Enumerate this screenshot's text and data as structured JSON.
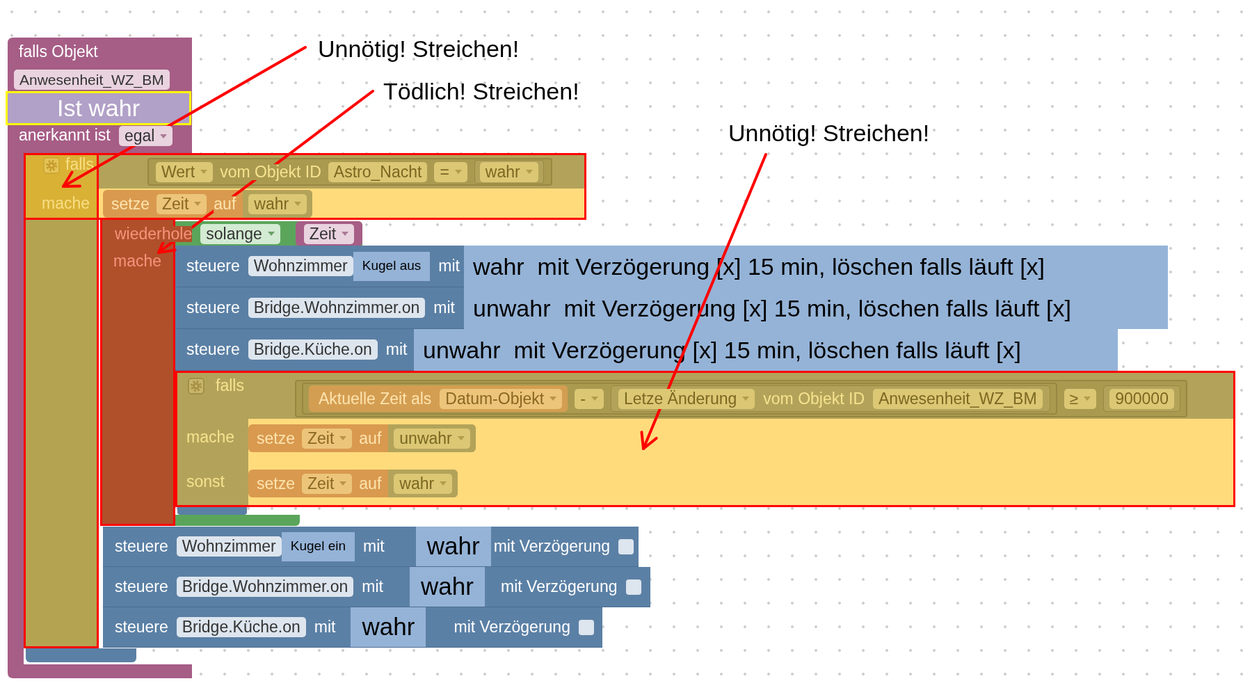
{
  "trigger_block": {
    "title": "falls Objekt",
    "object_id": "Anwesenheit_WZ_BM",
    "acknowledged_label": "anerkannt ist",
    "acknowledged_value": "egal"
  },
  "trigger_note": "Ist wahr",
  "astro_if_block": {
    "keyword": "falls",
    "condition": {
      "property": "Wert",
      "from_label": "vom Objekt ID",
      "object_id": "Astro_Nacht",
      "operator": "=",
      "value": "wahr"
    },
    "do_label": "mache",
    "statement": {
      "keyword": "setze",
      "variable": "Zeit",
      "to_label": "auf",
      "value": "wahr"
    }
  },
  "repeat_block": {
    "keyword": "wiederhole",
    "mode": "solange",
    "variable": "Zeit",
    "do_label": "mache",
    "control_statements": [
      {
        "keyword": "steuere",
        "object_id": "Wohnzimmer",
        "note": "Kugel aus",
        "with_label": "mit",
        "overlay_text": "wahr  mit Verzögerung [x] 15 min, löschen falls läuft [x]"
      },
      {
        "keyword": "steuere",
        "object_id": "Bridge.Wohnzimmer.on",
        "with_label": "mit",
        "overlay_text": "unwahr  mit Verzögerung [x] 15 min, löschen falls läuft [x]"
      },
      {
        "keyword": "steuere",
        "object_id": "Bridge.Küche.on",
        "with_label": "mit",
        "overlay_text": "unwahr  mit Verzögerung [x] 15 min, löschen falls läuft [x]"
      }
    ],
    "if_else_block": {
      "keyword": "falls",
      "condition": {
        "time_label": "Aktuelle Zeit als",
        "time_format": "Datum-Objekt",
        "math_operator": "-",
        "property": "Letze Änderung",
        "from_label": "vom Objekt ID",
        "object_id": "Anwesenheit_WZ_BM",
        "comparison": "≥",
        "threshold": "900000"
      },
      "do_label": "mache",
      "do_statement": {
        "keyword": "setze",
        "variable": "Zeit",
        "to_label": "auf",
        "value": "unwahr"
      },
      "else_label": "sonst",
      "else_statement": {
        "keyword": "setze",
        "variable": "Zeit",
        "to_label": "auf",
        "value": "wahr"
      }
    }
  },
  "control_statements": [
    {
      "keyword": "steuere",
      "object_id": "Wohnzimmer",
      "note": "Kugel ein",
      "with_label": "mit",
      "value": "wahr",
      "delay_label": "mit Verzögerung",
      "delay_checked": false
    },
    {
      "keyword": "steuere",
      "object_id": "Bridge.Wohnzimmer.on",
      "with_label": "mit",
      "value": "wahr",
      "delay_label": "mit Verzögerung",
      "delay_checked": false
    },
    {
      "keyword": "steuere",
      "object_id": "Bridge.Küche.on",
      "with_label": "mit",
      "value": "wahr",
      "delay_label": "mit Verzögerung",
      "delay_checked": false
    }
  ],
  "annotations": [
    {
      "text": "Unnötig! Streichen!"
    },
    {
      "text": "Tödlich! Streichen!"
    },
    {
      "text": "Unnötig! Streichen!"
    }
  ]
}
